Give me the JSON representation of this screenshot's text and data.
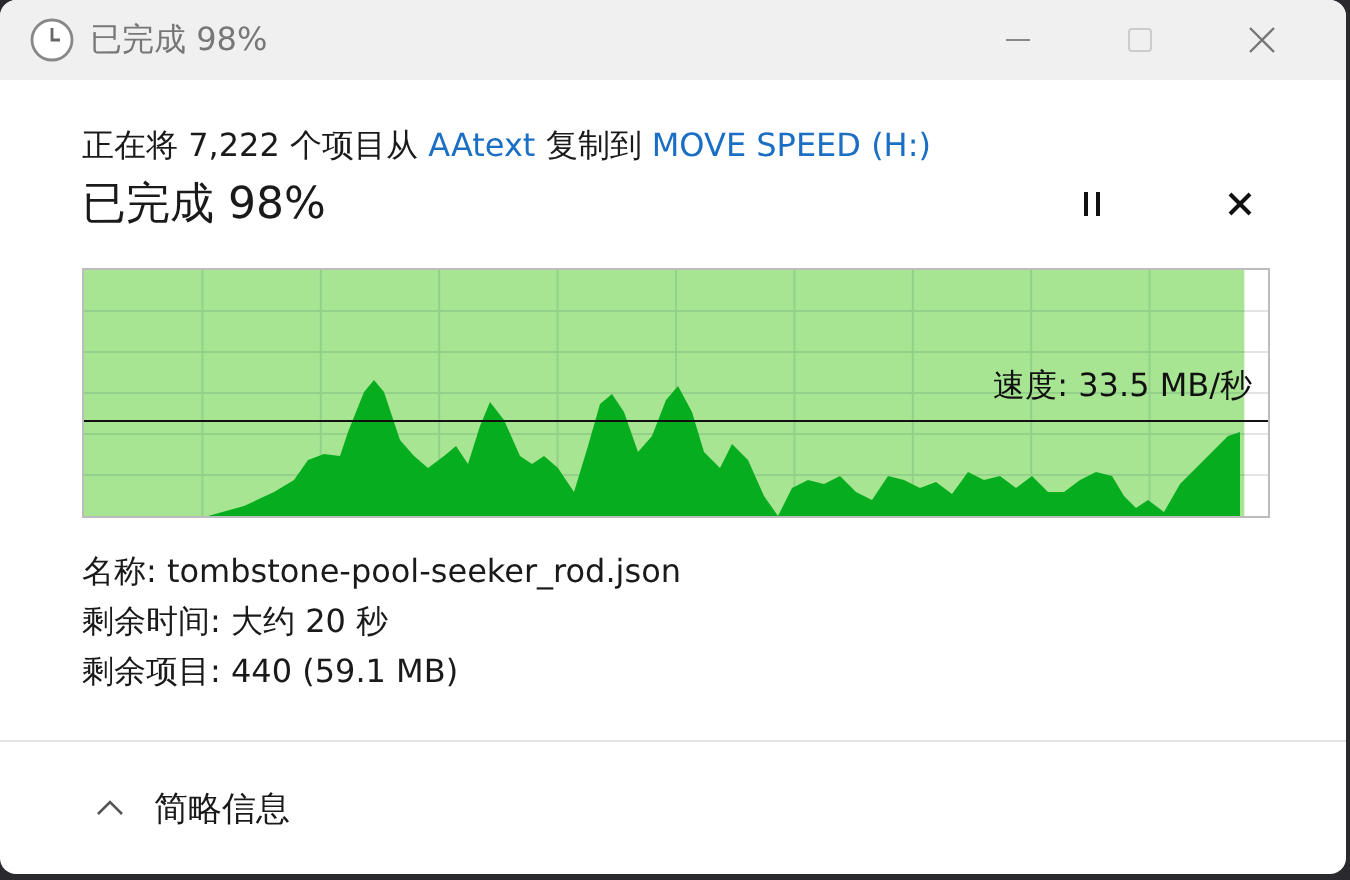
{
  "window": {
    "title": "已完成 98%"
  },
  "header": {
    "parts": [
      {
        "kind": "text",
        "text": "正在将 7,222 个项目从 "
      },
      {
        "kind": "link",
        "text": "AAtext"
      },
      {
        "kind": "text",
        "text": " 复制到 "
      },
      {
        "kind": "link",
        "text": "MOVE SPEED (H:)"
      }
    ]
  },
  "status": "已完成 98%",
  "progress": {
    "level": 0.98,
    "speed": "速度: 33.5 MB/秒"
  },
  "details": [
    {
      "label": "名称:",
      "value": "tombstone-pool-seeker_rod.json"
    },
    {
      "label": "剩余时间:",
      "value": "大约 20 秒"
    },
    {
      "label": "剩余项目:",
      "value": "440 (59.1 MB)"
    }
  ],
  "footer": {
    "toggle": "简略信息",
    "expanded": true
  }
}
